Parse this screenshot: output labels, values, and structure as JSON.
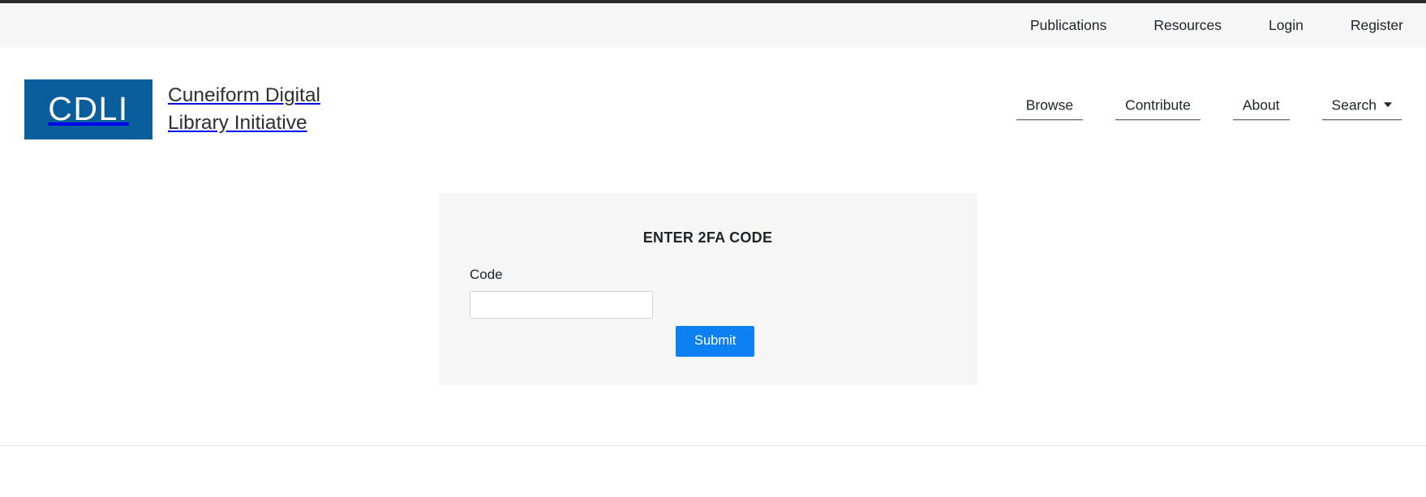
{
  "utility_nav": {
    "items": [
      {
        "label": "Publications"
      },
      {
        "label": "Resources"
      },
      {
        "label": "Login"
      },
      {
        "label": "Register"
      }
    ]
  },
  "brand": {
    "mark_text": "CDLI",
    "name": "Cuneiform Digital\nLibrary Initiative",
    "mark_color": "#0b5e9c"
  },
  "primary_nav": {
    "items": [
      {
        "label": "Browse",
        "has_caret": false
      },
      {
        "label": "Contribute",
        "has_caret": false
      },
      {
        "label": "About",
        "has_caret": false
      },
      {
        "label": "Search",
        "has_caret": true
      }
    ]
  },
  "auth_card": {
    "title": "ENTER 2FA CODE",
    "code_label": "Code",
    "code_value": "",
    "code_placeholder": "",
    "submit_label": "Submit",
    "submit_color": "#0d80f2",
    "background_color": "#f6f6f6"
  }
}
